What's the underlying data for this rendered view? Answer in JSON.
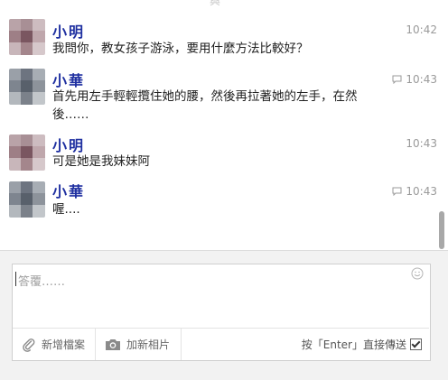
{
  "top_stub": "與",
  "messages": [
    {
      "sender": "小明",
      "time": "10:42",
      "text": "我問你，教女孩子游泳，要用什麼方法比較好？",
      "has_reply_icon": false
    },
    {
      "sender": "小華",
      "time": "10:43",
      "text": "首先用左手輕輕攬住她的腰，然後再拉著她的左手，在然後……",
      "has_reply_icon": true
    },
    {
      "sender": "小明",
      "time": "10:43",
      "text": "可是她是我妹妹阿",
      "has_reply_icon": false
    },
    {
      "sender": "小華",
      "time": "10:43",
      "text": "喔....",
      "has_reply_icon": true
    }
  ],
  "composer": {
    "placeholder": "答覆……",
    "attach_label": "新增檔案",
    "photo_label": "加新相片",
    "enter_to_send_label": "按「Enter」直接傳送",
    "enter_to_send_checked": true
  },
  "colors": {
    "name": "#1e2fa0",
    "time": "#9a9a9a",
    "panel": "#f2f2f2"
  }
}
